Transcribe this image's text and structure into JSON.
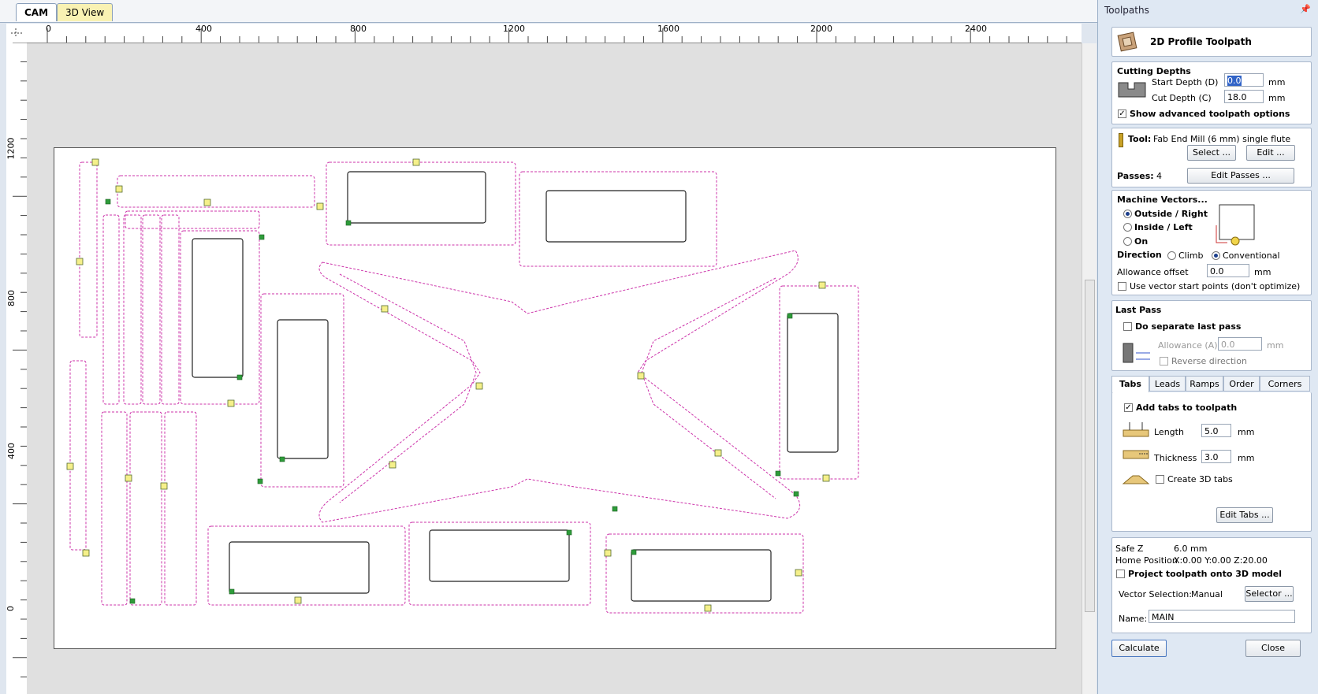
{
  "doc_tabs": {
    "cam": "CAM",
    "view3d": "3D View"
  },
  "ruler": {
    "top_labels": [
      "0",
      "400",
      "800",
      "1200",
      "1600",
      "2000",
      "2400"
    ],
    "left_labels": [
      "1200",
      "800",
      "400",
      "0"
    ]
  },
  "panel": {
    "title": "Toolpaths",
    "toolpath_name": "2D Profile Toolpath",
    "cutting_depths": {
      "heading": "Cutting Depths",
      "start_label": "Start Depth (D)",
      "start_value": "0.0",
      "cut_label": "Cut Depth (C)",
      "cut_value": "18.0",
      "unit": "mm",
      "advanced_label": "Show advanced toolpath options"
    },
    "tool": {
      "label": "Tool:",
      "name": "Fab End Mill (6 mm) single flute",
      "select_btn": "Select ...",
      "edit_btn": "Edit ...",
      "passes_label": "Passes:",
      "passes_value": "4",
      "edit_passes_btn": "Edit Passes ..."
    },
    "machine_vectors": {
      "heading": "Machine Vectors...",
      "outside": "Outside / Right",
      "inside": "Inside / Left",
      "on": "On",
      "direction_label": "Direction",
      "climb": "Climb",
      "conventional": "Conventional",
      "allowance_label": "Allowance offset",
      "allowance_value": "0.0",
      "unit": "mm",
      "start_points_label": "Use vector start points (don't optimize)"
    },
    "last_pass": {
      "heading": "Last Pass",
      "separate_label": "Do separate last pass",
      "allowance_label": "Allowance (A)",
      "allowance_value": "0.0",
      "unit": "mm",
      "reverse_label": "Reverse direction"
    },
    "tabs": {
      "names": [
        "Tabs",
        "Leads",
        "Ramps",
        "Order",
        "Corners"
      ],
      "add_label": "Add tabs to toolpath",
      "length_label": "Length",
      "length_value": "5.0",
      "thickness_label": "Thickness",
      "thickness_value": "3.0",
      "unit": "mm",
      "create3d_label": "Create 3D tabs",
      "edit_btn": "Edit Tabs ..."
    },
    "footer": {
      "safez_label": "Safe Z",
      "safez_value": "6.0 mm",
      "home_label": "Home Position",
      "home_value": "X:0.00 Y:0.00 Z:20.00",
      "project_label": "Project toolpath onto 3D model",
      "vecsel_label": "Vector Selection:",
      "vecsel_value": "Manual",
      "selector_btn": "Selector ...",
      "name_label": "Name:",
      "name_value": "MAIN",
      "calculate_btn": "Calculate",
      "close_btn": "Close"
    }
  }
}
